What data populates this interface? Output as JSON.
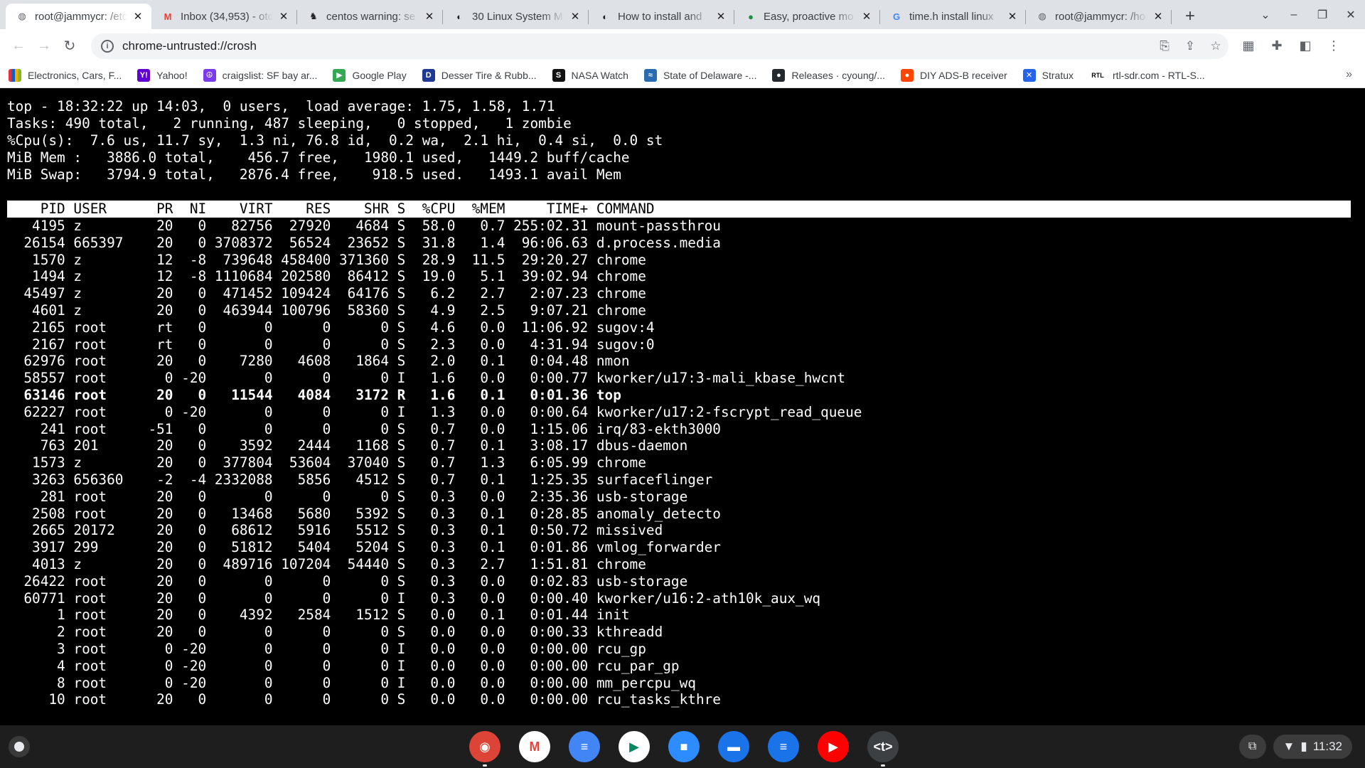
{
  "tabs": [
    {
      "title": "root@jammycr: /etc",
      "icon": "globe-icon",
      "active": true
    },
    {
      "title": "Inbox (34,953) - otc",
      "icon": "gmail-icon"
    },
    {
      "title": "centos warning: se",
      "icon": "gnu-icon"
    },
    {
      "title": "30 Linux System M",
      "icon": "tecmint-icon"
    },
    {
      "title": "How to install and",
      "icon": "tecmint-icon"
    },
    {
      "title": "Easy, proactive mo",
      "icon": "green-dot-icon"
    },
    {
      "title": "time.h install linux",
      "icon": "google-icon"
    },
    {
      "title": "root@jammycr: /ho",
      "icon": "globe-icon"
    }
  ],
  "toolbar": {
    "url": "chrome-untrusted://crosh"
  },
  "bookmarks": [
    {
      "label": "Electronics, Cars, F...",
      "icon": "ebay-icon",
      "color": "#e53238"
    },
    {
      "label": "Yahoo!",
      "icon": "yahoo-icon",
      "color": "#6001d2",
      "glyph": "Y!"
    },
    {
      "label": "craigslist: SF bay ar...",
      "icon": "peace-icon",
      "color": "#7c3aed",
      "glyph": "☮"
    },
    {
      "label": "Google Play",
      "icon": "play-icon",
      "color": "#34a853",
      "glyph": "▶"
    },
    {
      "label": "Desser Tire & Rubb...",
      "icon": "desser-icon",
      "color": "#1f3a93",
      "glyph": "D"
    },
    {
      "label": "NASA Watch",
      "icon": "nasa-icon",
      "color": "#111111",
      "glyph": "S"
    },
    {
      "label": "State of Delaware -...",
      "icon": "delaware-icon",
      "color": "#2b6cb0",
      "glyph": "≈"
    },
    {
      "label": "Releases · cyoung/...",
      "icon": "github-icon",
      "color": "#24292e",
      "glyph": "●"
    },
    {
      "label": "DIY ADS-B receiver",
      "icon": "reddit-icon",
      "color": "#ff4500",
      "glyph": "●"
    },
    {
      "label": "Stratux",
      "icon": "stratux-icon",
      "color": "#2563eb",
      "glyph": "✕"
    },
    {
      "label": "rtl-sdr.com - RTL-S...",
      "icon": "rtl-icon",
      "color": "#ffffff",
      "glyph": "RTL"
    }
  ],
  "top": {
    "summary": [
      "top - 18:32:22 up 14:03,  0 users,  load average: 1.75, 1.58, 1.71",
      "Tasks: 490 total,   2 running, 487 sleeping,   0 stopped,   1 zombie",
      "%Cpu(s):  7.6 us, 11.7 sy,  1.3 ni, 76.8 id,  0.2 wa,  2.1 hi,  0.4 si,  0.0 st",
      "MiB Mem :   3886.0 total,    456.7 free,   1980.1 used,   1449.2 buff/cache",
      "MiB Swap:   3794.9 total,   2876.4 free,    918.5 used.   1493.1 avail Mem"
    ],
    "header": "    PID USER      PR  NI    VIRT    RES    SHR S  %CPU  %MEM     TIME+ COMMAND",
    "rows": [
      "   4195 z         20   0   82756  27920   4684 S  58.0   0.7 255:02.31 mount-passthrou",
      "  26154 665397    20   0 3708372  56524  23652 S  31.8   1.4  96:06.63 d.process.media",
      "   1570 z         12  -8  739648 458400 371360 S  28.9  11.5  29:20.27 chrome",
      "   1494 z         12  -8 1110684 202580  86412 S  19.0   5.1  39:02.94 chrome",
      "  45497 z         20   0  471452 109424  64176 S   6.2   2.7   2:07.23 chrome",
      "   4601 z         20   0  463944 100796  58360 S   4.9   2.5   9:07.21 chrome",
      "   2165 root      rt   0       0      0      0 S   4.6   0.0  11:06.92 sugov:4",
      "   2167 root      rt   0       0      0      0 S   2.3   0.0   4:31.94 sugov:0",
      "  62976 root      20   0    7280   4608   1864 S   2.0   0.1   0:04.48 nmon",
      "  58557 root       0 -20       0      0      0 I   1.6   0.0   0:00.77 kworker/u17:3-mali_kbase_hwcnt",
      "  63146 root      20   0   11544   4084   3172 R   1.6   0.1   0:01.36 top",
      "  62227 root       0 -20       0      0      0 I   1.3   0.0   0:00.64 kworker/u17:2-fscrypt_read_queue",
      "    241 root     -51   0       0      0      0 S   0.7   0.0   1:15.06 irq/83-ekth3000",
      "    763 201       20   0    3592   2444   1168 S   0.7   0.1   3:08.17 dbus-daemon",
      "   1573 z         20   0  377804  53604  37040 S   0.7   1.3   6:05.99 chrome",
      "   3263 656360    -2  -4 2332088   5856   4512 S   0.7   0.1   1:25.35 surfaceflinger",
      "    281 root      20   0       0      0      0 S   0.3   0.0   2:35.36 usb-storage",
      "   2508 root      20   0   13468   5680   5392 S   0.3   0.1   0:28.85 anomaly_detecto",
      "   2665 20172     20   0   68612   5916   5512 S   0.3   0.1   0:50.72 missived",
      "   3917 299       20   0   51812   5404   5204 S   0.3   0.1   0:01.86 vmlog_forwarder",
      "   4013 z         20   0  489716 107204  54440 S   0.3   2.7   1:51.81 chrome",
      "  26422 root      20   0       0      0      0 S   0.3   0.0   0:02.83 usb-storage",
      "  60771 root      20   0       0      0      0 I   0.3   0.0   0:00.40 kworker/u16:2-ath10k_aux_wq",
      "      1 root      20   0    4392   2584   1512 S   0.0   0.1   0:01.44 init",
      "      2 root      20   0       0      0      0 S   0.0   0.0   0:00.33 kthreadd",
      "      3 root       0 -20       0      0      0 I   0.0   0.0   0:00.00 rcu_gp",
      "      4 root       0 -20       0      0      0 I   0.0   0.0   0:00.00 rcu_par_gp",
      "      8 root       0 -20       0      0      0 I   0.0   0.0   0:00.00 mm_percpu_wq",
      "     10 root      20   0       0      0      0 S   0.0   0.0   0:00.00 rcu_tasks_kthre"
    ]
  },
  "shelf": {
    "apps": [
      {
        "name": "chrome-app-icon",
        "color": "#db4437",
        "glyph": "◉"
      },
      {
        "name": "gmail-app-icon",
        "color": "#ffffff",
        "glyph": "M"
      },
      {
        "name": "docs-app-icon",
        "color": "#4285f4",
        "glyph": "≡"
      },
      {
        "name": "play-store-app-icon",
        "color": "#ffffff",
        "glyph": "▶"
      },
      {
        "name": "zoom-app-icon",
        "color": "#2d8cff",
        "glyph": "■"
      },
      {
        "name": "files-app-icon",
        "color": "#1a73e8",
        "glyph": "▬"
      },
      {
        "name": "messages-app-icon",
        "color": "#1a73e8",
        "glyph": "≡"
      },
      {
        "name": "youtube-app-icon",
        "color": "#ff0000",
        "glyph": "▶"
      },
      {
        "name": "terminal-app-icon",
        "color": "#3c4043",
        "glyph": "<t>"
      }
    ],
    "time": "11:32"
  }
}
